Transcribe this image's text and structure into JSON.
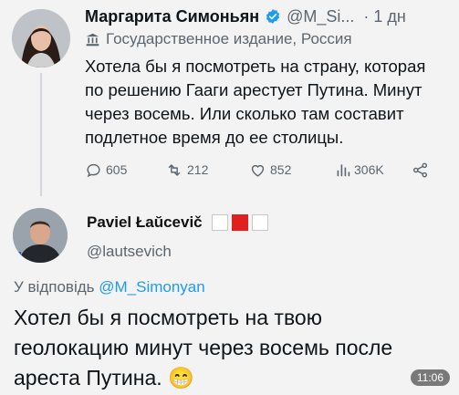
{
  "tweet1": {
    "author_name": "Маргарита Симоньян",
    "handle": "@M_Si...",
    "time": "· 1 дн",
    "label_text": "Государственное издание, Россия",
    "text": "Хотела бы я посмотреть на страну, которая\nпо решению Гааги арестует Путина. Минут\nчерез восемь. Или сколько там составит\nподлетное время до ее столицы.",
    "stats": {
      "replies": "605",
      "retweets": "212",
      "likes": "852",
      "views": "306K"
    },
    "verified_color": "#1d9bf0"
  },
  "tweet2": {
    "author_name": "Paviel Łaŭcevič",
    "handle": "@lautsevich",
    "reply_prefix": "У відповідь",
    "reply_handle": "@M_Simonyan",
    "text": "Хотел бы я посмотреть на твою\nгеолокацию минут через восемь после\nареста Путина. 😁"
  },
  "overlay": {
    "time_badge": "11:06"
  },
  "icons": [
    "verified-icon",
    "government-building-icon",
    "reply-icon",
    "retweet-icon",
    "like-icon",
    "views-icon",
    "share-icon"
  ],
  "colors": {
    "link": "#1d9bf0",
    "secondary_text": "#5b6670",
    "background": "#f3f3f3"
  }
}
